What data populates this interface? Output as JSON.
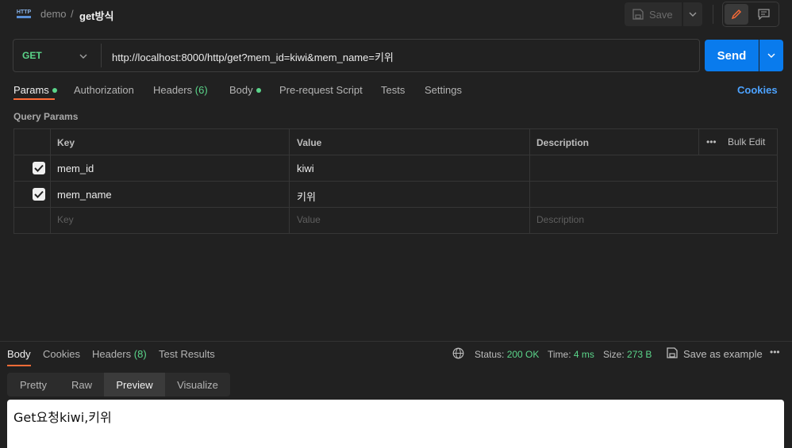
{
  "breadcrumb": {
    "parent": "demo",
    "separator": "/",
    "current": "get방식",
    "icon": "HTTP"
  },
  "toolbar": {
    "save_label": "Save"
  },
  "request": {
    "method": "GET",
    "url": "http://localhost:8000/http/get?mem_id=kiwi&mem_name=키위",
    "send_label": "Send"
  },
  "tabs": {
    "params": "Params",
    "authorization": "Authorization",
    "headers": "Headers",
    "headers_count": "(6)",
    "body": "Body",
    "prerequest": "Pre-request Script",
    "tests": "Tests",
    "settings": "Settings",
    "cookies": "Cookies"
  },
  "query_params": {
    "title": "Query Params",
    "columns": {
      "key": "Key",
      "value": "Value",
      "description": "Description"
    },
    "bulk_edit": "Bulk Edit",
    "more": "•••",
    "rows": [
      {
        "checked": true,
        "key": "mem_id",
        "value": "kiwi",
        "description": ""
      },
      {
        "checked": true,
        "key": "mem_name",
        "value": "키위",
        "description": ""
      }
    ],
    "placeholders": {
      "key": "Key",
      "value": "Value",
      "description": "Description"
    }
  },
  "response": {
    "tabs": {
      "body": "Body",
      "cookies": "Cookies",
      "headers": "Headers",
      "headers_count": "(8)",
      "test_results": "Test Results"
    },
    "status_label": "Status:",
    "status_value": "200 OK",
    "time_label": "Time:",
    "time_value": "4 ms",
    "size_label": "Size:",
    "size_value": "273 B",
    "save_example": "Save as example",
    "more": "•••",
    "views": {
      "pretty": "Pretty",
      "raw": "Raw",
      "preview": "Preview",
      "visualize": "Visualize"
    },
    "preview_body": "Get요청kiwi,키위"
  },
  "colors": {
    "accent_orange": "#ff6c37",
    "send_blue": "#097bed",
    "green": "#5bd58a",
    "link_blue": "#4da3ff"
  }
}
